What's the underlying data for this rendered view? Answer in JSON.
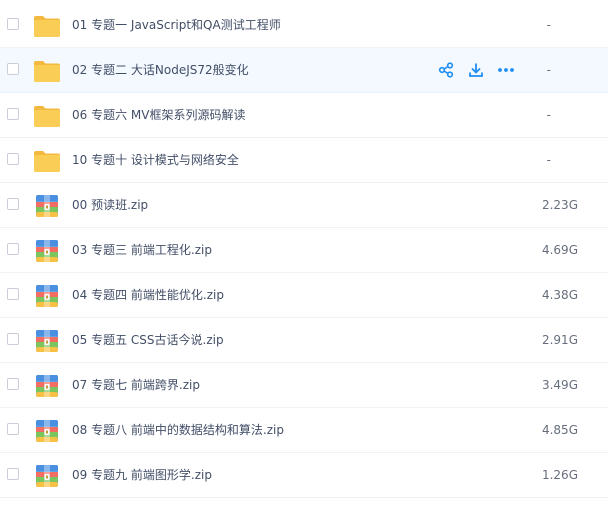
{
  "colors": {
    "accent": "#1e8ef3",
    "folder": "#f9cd56",
    "hover_row": "#f3f9fe",
    "text": "#424e67"
  },
  "actions": {
    "share_icon": "share-icon",
    "download_icon": "download-icon",
    "more_icon": "more-icon"
  },
  "files": [
    {
      "name": "01 专题一 JavaScript和QA测试工程师",
      "size": "-",
      "type": "folder"
    },
    {
      "name": "02 专题二 大话NodeJS72般变化",
      "size": "-",
      "type": "folder",
      "hovered": true
    },
    {
      "name": "06 专题六 MV框架系列源码解读",
      "size": "-",
      "type": "folder"
    },
    {
      "name": "10 专题十 设计模式与网络安全",
      "size": "-",
      "type": "folder"
    },
    {
      "name": "00 预读班.zip",
      "size": "2.23G",
      "type": "zip"
    },
    {
      "name": "03 专题三 前端工程化.zip",
      "size": "4.69G",
      "type": "zip"
    },
    {
      "name": "04 专题四 前端性能优化.zip",
      "size": "4.38G",
      "type": "zip"
    },
    {
      "name": "05 专题五 CSS古话今说.zip",
      "size": "2.91G",
      "type": "zip"
    },
    {
      "name": "07 专题七 前端跨界.zip",
      "size": "3.49G",
      "type": "zip"
    },
    {
      "name": "08 专题八 前端中的数据结构和算法.zip",
      "size": "4.85G",
      "type": "zip"
    },
    {
      "name": "09 专题九 前端图形学.zip",
      "size": "1.26G",
      "type": "zip"
    }
  ]
}
